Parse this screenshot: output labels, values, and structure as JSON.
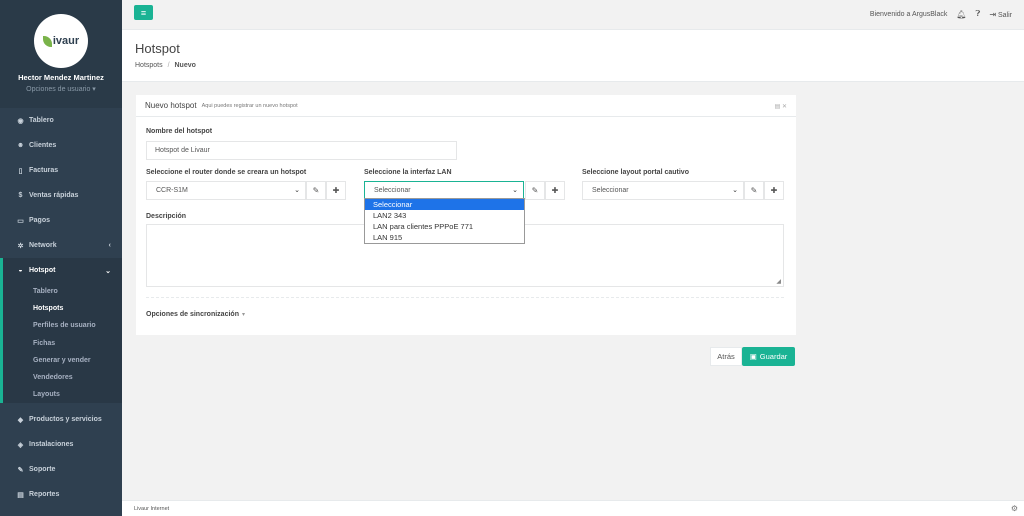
{
  "brand": {
    "logo_text": "ivaur",
    "logo_letter": "L",
    "accent": "#1ab394"
  },
  "user": {
    "name": "Hector Mendez Martinez",
    "options": "Opciones de usuario ▾"
  },
  "sidebar": {
    "items": [
      {
        "label": "Tablero",
        "icon": "dashboard-icon"
      },
      {
        "label": "Clientes",
        "icon": "users-icon"
      },
      {
        "label": "Facturas",
        "icon": "file-icon"
      },
      {
        "label": "Ventas rápidas",
        "icon": "dollar-icon"
      },
      {
        "label": "Pagos",
        "icon": "money-icon"
      },
      {
        "label": "Network",
        "icon": "network-icon"
      },
      {
        "label": "Hotspot",
        "icon": "wifi-icon"
      }
    ],
    "hotspot_sub": [
      "Tablero",
      "Hotspots",
      "Perfiles de usuario",
      "Fichas",
      "Generar y vender",
      "Vendedores",
      "Layouts"
    ],
    "bottom_items": [
      {
        "label": "Productos y servicios",
        "icon": "tag-icon"
      },
      {
        "label": "Instalaciones",
        "icon": "plug-icon"
      },
      {
        "label": "Soporte",
        "icon": "wrench-icon"
      },
      {
        "label": "Reportes",
        "icon": "book-icon"
      }
    ]
  },
  "topbar": {
    "welcome": "Bienvenido a ArgusBlack",
    "logout": "Salir"
  },
  "page": {
    "title": "Hotspot",
    "crumb_parent": "Hotspots",
    "crumb_sep": "/",
    "crumb_current": "Nuevo"
  },
  "form": {
    "panel_title": "Nuevo hotspot",
    "panel_subtitle": "Aqui puedes registrar un nuevo hotspot",
    "name_label": "Nombre del hotspot",
    "name_value": "Hotspot de Livaur",
    "router_label": "Seleccione el router donde se creara un hotspot",
    "router_value": "CCR-S1M",
    "lan_label": "Seleccione la interfaz LAN",
    "lan_value": "Seleccionar",
    "layout_label": "Seleccione layout portal cautivo",
    "layout_value": "Seleccionar",
    "desc_label": "Descripción",
    "sync_label": "Opciones de sincronización",
    "lan_options": [
      "Seleccionar",
      "LAN2 343",
      "LAN para clientes PPPoE 771",
      "LAN 915"
    ]
  },
  "actions": {
    "back": "Atrás",
    "save": "Guardar"
  },
  "footer": {
    "text": "Livaur Internet"
  }
}
